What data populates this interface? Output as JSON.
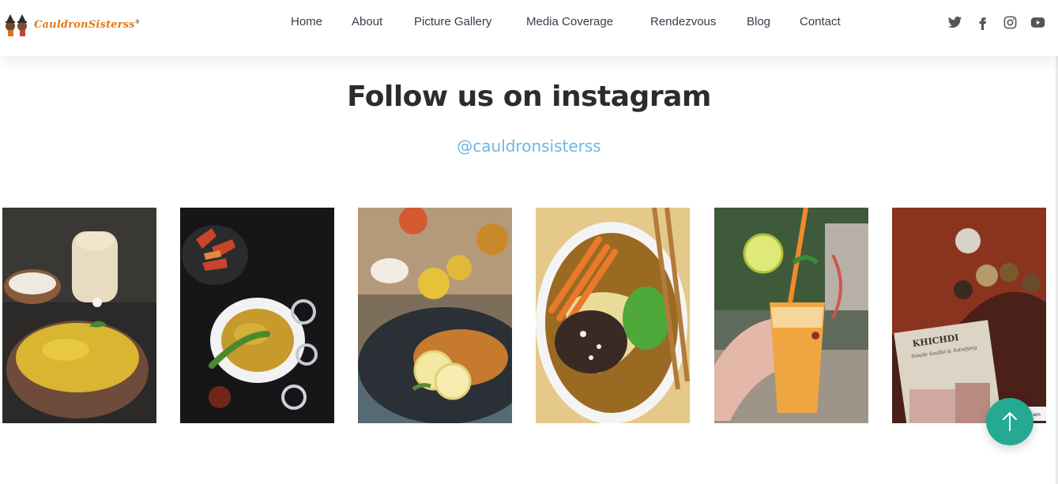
{
  "header": {
    "logo_text": "CauldronSisterss",
    "logo_mark": "®",
    "nav": [
      {
        "label": "Home"
      },
      {
        "label": "About"
      },
      {
        "label": "Picture Gallery"
      },
      {
        "label": "Media Coverage"
      },
      {
        "label": "Rendezvous"
      },
      {
        "label": "Blog"
      },
      {
        "label": "Contact"
      }
    ],
    "social": [
      "twitter-icon",
      "facebook-icon",
      "instagram-icon",
      "youtube-icon"
    ]
  },
  "instagram": {
    "title": "Follow us on instagram",
    "handle": "@cauldronsisterss",
    "posts": [
      {
        "subject": "yellow khichdi in clay pot with buttermilk"
      },
      {
        "subject": "khichdi with green chilli and pickle on black board"
      },
      {
        "subject": "dal with lemon slices on dark plate"
      },
      {
        "subject": "ramen bowl with carrots and chopsticks"
      },
      {
        "subject": "hand holding orange cooler with lime"
      },
      {
        "subject": "Khichdi book cover with spices"
      }
    ],
    "book_cover_title": "KHICHDI",
    "book_cover_subtitle": "Simple Soulful & Satisfying",
    "corner_text": "gram"
  },
  "colors": {
    "accent_blue": "#6ab7e4",
    "logo_orange": "#e37a1a",
    "teal_button": "#25a992",
    "nav_text": "#3d3a4b"
  },
  "scroll_top": {
    "icon": "arrow-up-icon"
  }
}
